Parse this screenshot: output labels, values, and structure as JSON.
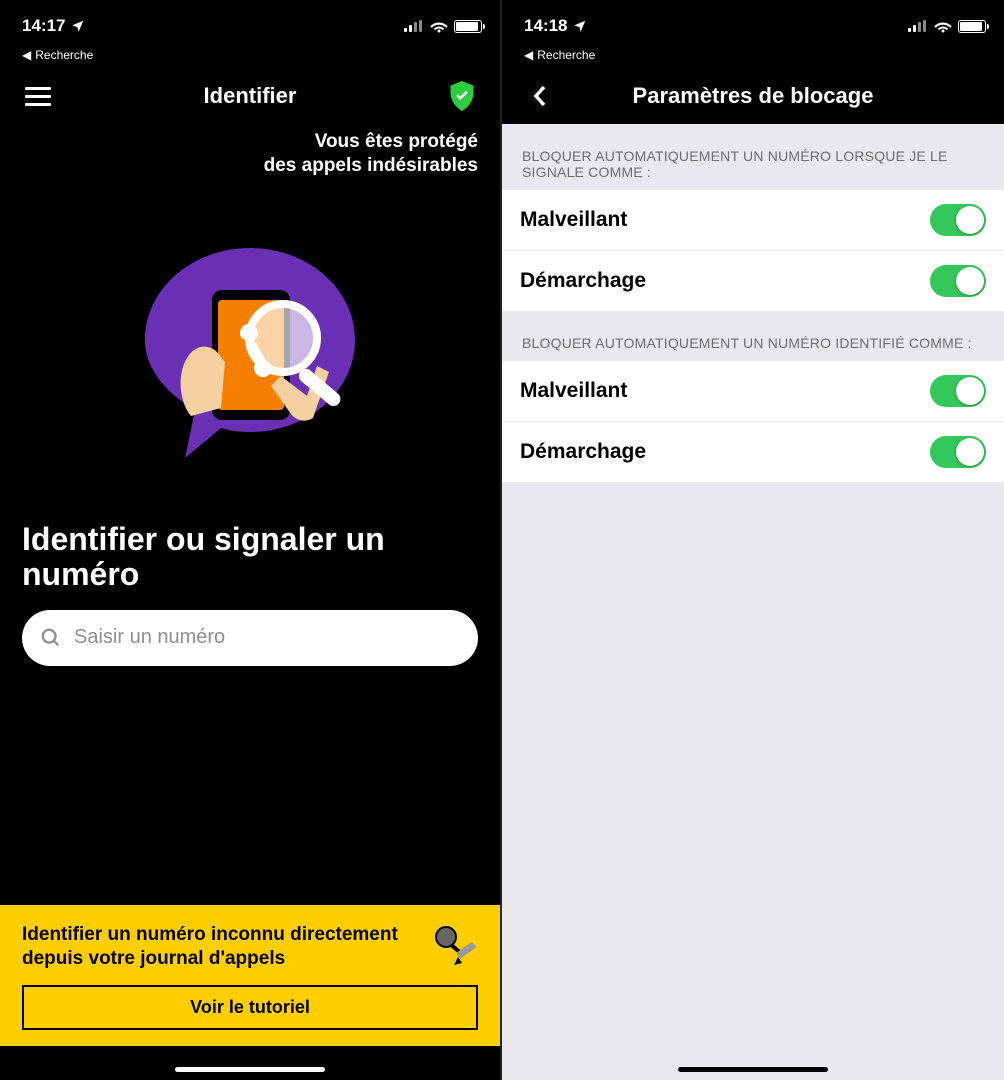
{
  "left": {
    "status_time": "14:17",
    "back_app": "Recherche",
    "nav_title": "Identifier",
    "protect_line1": "Vous êtes protégé",
    "protect_line2": "des appels indésirables",
    "headline": "Identifier ou signaler un numéro",
    "search_placeholder": "Saisir un numéro",
    "banner_text": "Identifier un numéro inconnu directement depuis votre journal d'appels",
    "banner_button": "Voir le tutoriel"
  },
  "right": {
    "status_time": "14:18",
    "back_app": "Recherche",
    "nav_title": "Paramètres de blocage",
    "section1_header": "BLOQUER AUTOMATIQUEMENT UN NUMÉRO LORSQUE JE LE SIGNALE COMME :",
    "section1_row1": "Malveillant",
    "section1_row2": "Démarchage",
    "section2_header": "BLOQUER AUTOMATIQUEMENT UN NUMÉRO IDENTIFIÉ COMME :",
    "section2_row1": "Malveillant",
    "section2_row2": "Démarchage"
  }
}
